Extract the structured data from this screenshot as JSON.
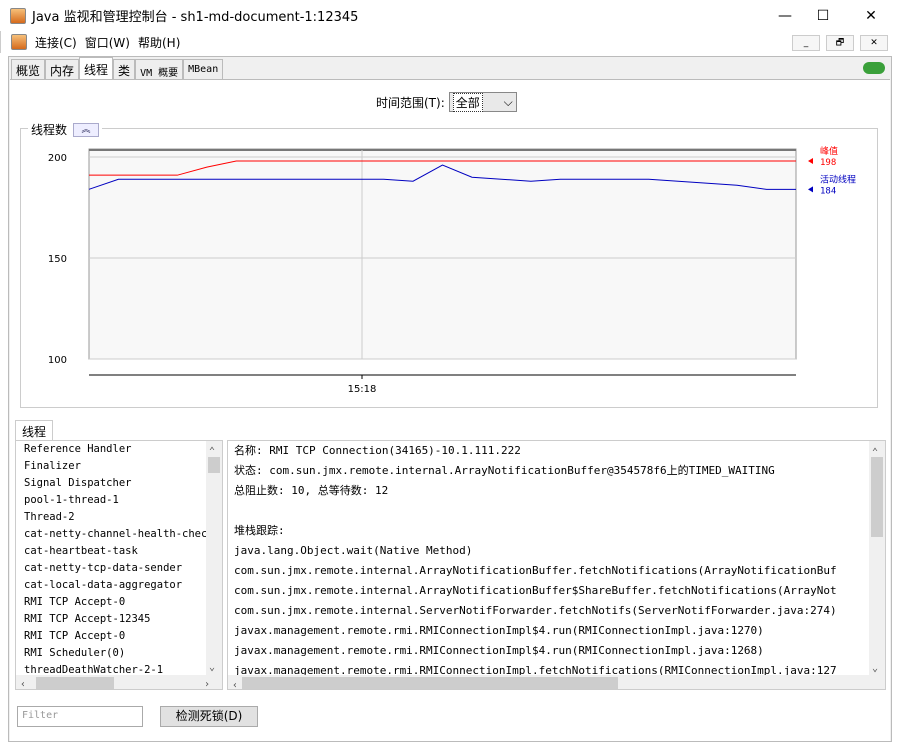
{
  "window": {
    "title": "Java 监视和管理控制台 - sh1-md-document-1:12345",
    "controls": [
      "—",
      "☐",
      "✕"
    ]
  },
  "menu": [
    "连接(C)",
    "窗口(W)",
    "帮助(H)"
  ],
  "mdi_controls": [
    "_",
    "🗗",
    "✕"
  ],
  "tabs": [
    "概览",
    "内存",
    "线程",
    "类",
    "VM 概要",
    "MBean"
  ],
  "active_tab": "线程",
  "time_range": {
    "label": "时间范围(T):",
    "value": "全部"
  },
  "chart_title": "线程数",
  "chart_data": {
    "type": "line",
    "title": "线程数",
    "y_ticks": [
      "200",
      "150",
      "100"
    ],
    "ylim": [
      100,
      200
    ],
    "x_ticks": [
      "15:18"
    ],
    "grid": true,
    "legend_placement": "right",
    "series": [
      {
        "name": "峰值",
        "latest": "198",
        "color": "#ff0000",
        "values": [
          191,
          191,
          191,
          191,
          195,
          198,
          198,
          198,
          198,
          198,
          198,
          198,
          198,
          198,
          198,
          198,
          198,
          198,
          198,
          198,
          198,
          198,
          198,
          198,
          198
        ]
      },
      {
        "name": "活动线程",
        "latest": "184",
        "color": "#0000c0",
        "values": [
          184,
          189,
          189,
          189,
          189,
          189,
          189,
          189,
          189,
          189,
          189,
          188,
          196,
          190,
          189,
          188,
          189,
          189,
          189,
          189,
          188,
          187,
          186,
          184,
          184
        ]
      }
    ]
  },
  "threads_tab": "线程",
  "threads": [
    "Reference Handler",
    "Finalizer",
    "Signal Dispatcher",
    "pool-1-thread-1",
    "Thread-2",
    "cat-netty-channel-health-check",
    "cat-heartbeat-task",
    "cat-netty-tcp-data-sender",
    "cat-local-data-aggregator",
    "RMI TCP Accept-0",
    "RMI TCP Accept-12345",
    "RMI TCP Accept-0",
    "RMI Scheduler(0)",
    "threadDeathWatcher-2-1"
  ],
  "detail": [
    "名称: RMI TCP Connection(34165)-10.1.111.222",
    "状态: com.sun.jmx.remote.internal.ArrayNotificationBuffer@354578f6上的TIMED_WAITING",
    "总阻止数: 10, 总等待数: 12",
    "",
    "堆栈跟踪:",
    "java.lang.Object.wait(Native Method)",
    "com.sun.jmx.remote.internal.ArrayNotificationBuffer.fetchNotifications(ArrayNotificationBuf",
    "com.sun.jmx.remote.internal.ArrayNotificationBuffer$ShareBuffer.fetchNotifications(ArrayNot",
    "com.sun.jmx.remote.internal.ServerNotifForwarder.fetchNotifs(ServerNotifForwarder.java:274)",
    "javax.management.remote.rmi.RMIConnectionImpl$4.run(RMIConnectionImpl.java:1270)",
    "javax.management.remote.rmi.RMIConnectionImpl$4.run(RMIConnectionImpl.java:1268)",
    "javax.management.remote.rmi.RMIConnectionImpl.fetchNotifications(RMIConnectionImpl.java:127"
  ],
  "filter_placeholder": "Filter",
  "detect_deadlock": "检测死锁(D)"
}
